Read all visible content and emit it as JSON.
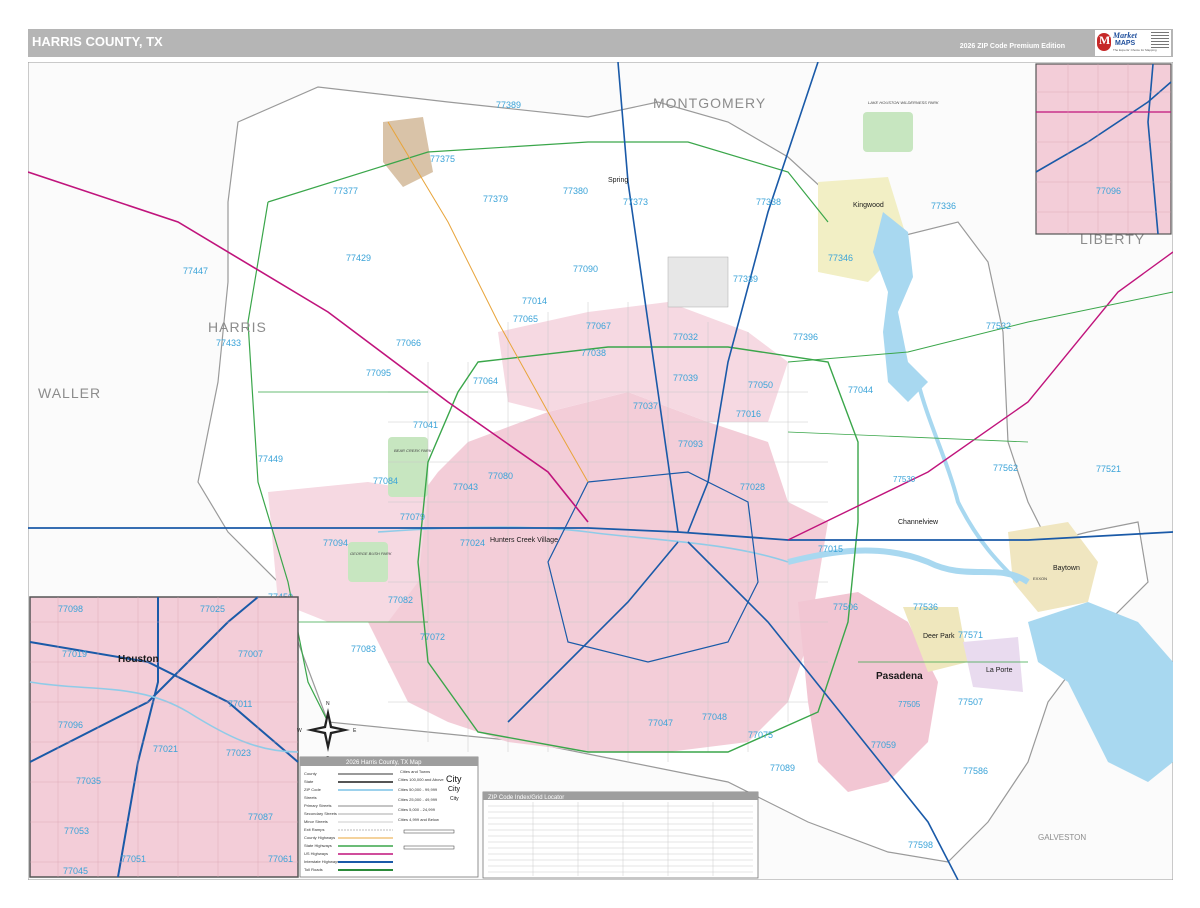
{
  "header": {
    "title": "HARRIS COUNTY, TX",
    "edition": "2026 ZIP Code Premium Edition",
    "logo_line1": "Market",
    "logo_line2": "MAPS",
    "logo_line3": "The Experts' Choice for Mapping"
  },
  "counties": {
    "harris": "HARRIS",
    "montgomery": "MONTGOMERY",
    "waller": "WALLER",
    "liberty": "LIBERTY",
    "galveston": "GALVESTON"
  },
  "cities": {
    "houston": "Houston",
    "pasadena": "Pasadena",
    "baytown": "Baytown",
    "spring": "Spring",
    "kingwood": "Kingwood",
    "channelview": "Channelview",
    "hunters_creek": "Hunters Creek Village",
    "deer_park": "Deer Park",
    "la_porte": "La Porte",
    "exxon": "EXXON"
  },
  "parks": {
    "lake_houston": "LAKE HOUSTON WILDERNESS PARK",
    "bear_creek": "BEAR CREEK PARK",
    "george_bush": "GEORGE BUSH PARK"
  },
  "zips": {
    "z77389": "77389",
    "z77375": "77375",
    "z77377": "77377",
    "z77379": "77379",
    "z77380": "77380",
    "z77373": "77373",
    "z77338": "77338",
    "z77336": "77336",
    "z77447": "77447",
    "z77429": "77429",
    "z77090": "77090",
    "z77339": "77339",
    "z77346": "77346",
    "z77014": "77014",
    "z77065": "77065",
    "z77067": "77067",
    "z77032": "77032",
    "z77396": "77396",
    "z77532": "77532",
    "z77433": "77433",
    "z77066": "77066",
    "z77038": "77038",
    "z77095": "77095",
    "z77064": "77064",
    "z77039": "77039",
    "z77050": "77050",
    "z77044": "77044",
    "z77037": "77037",
    "z77041": "77041",
    "z77016": "77016",
    "z77449": "77449",
    "z77093": "77093",
    "z77084": "77084",
    "z77043": "77043",
    "z77080": "77080",
    "z77028": "77028",
    "z77562": "77562",
    "z77521": "77521",
    "z77530": "77530",
    "z77079": "77079",
    "z77024": "77024",
    "z77015": "77015",
    "z77094": "77094",
    "z77450": "77450",
    "z77082": "77082",
    "z77506": "77506",
    "z77536": "77536",
    "z77571": "77571",
    "z77072": "77072",
    "z77083": "77083",
    "z77505": "77505",
    "z77507": "77507",
    "z77047": "77047",
    "z77048": "77048",
    "z77075": "77075",
    "z77059": "77059",
    "z77089": "77089",
    "z77586": "77586",
    "z77598": "77598",
    "z77098": "77098",
    "z77096": "77096",
    "z77053": "77053",
    "z77051": "77051",
    "z77045": "77045",
    "z77061": "77061",
    "z77087": "77087",
    "z77035": "77035",
    "z77023": "77023",
    "z77021": "77021",
    "z77011": "77011",
    "z77007": "77007",
    "z77019": "77019",
    "z77025": "77025"
  },
  "legend": {
    "title": "2026 Harris County, TX Map",
    "cities_header": "Cities and Towns",
    "city_classes": [
      "Cities 100,000 and Above",
      "Cities 50,000 - 99,999",
      "Cities 25,000 - 49,999",
      "Cities 5,000 - 24,999",
      "Cities 4,999 and Below"
    ],
    "feature_names": [
      "County",
      "State",
      "ZIP Code",
      "Streets",
      "Primary Streets",
      "Secondary Streets",
      "Minor Streets",
      "Exit Ramps",
      "County Highways",
      "State Highways",
      "US Highways",
      "Interstate Highways",
      "Toll Roads"
    ],
    "sample_city": "City"
  },
  "index": {
    "title": "ZIP Code Index/Grid Locator"
  },
  "compass": {
    "n": "N",
    "s": "S",
    "e": "E",
    "w": "W"
  },
  "colors": {
    "urban": "#f3cdd8",
    "zip_label": "#3aa3d8",
    "water": "#a8d8f0",
    "interstate": "#1a5aa8",
    "us_highway": "#c0147c",
    "state_highway": "#3aa64a",
    "county_text": "#8c8c8c",
    "header_bar": "#b5b5b5"
  }
}
